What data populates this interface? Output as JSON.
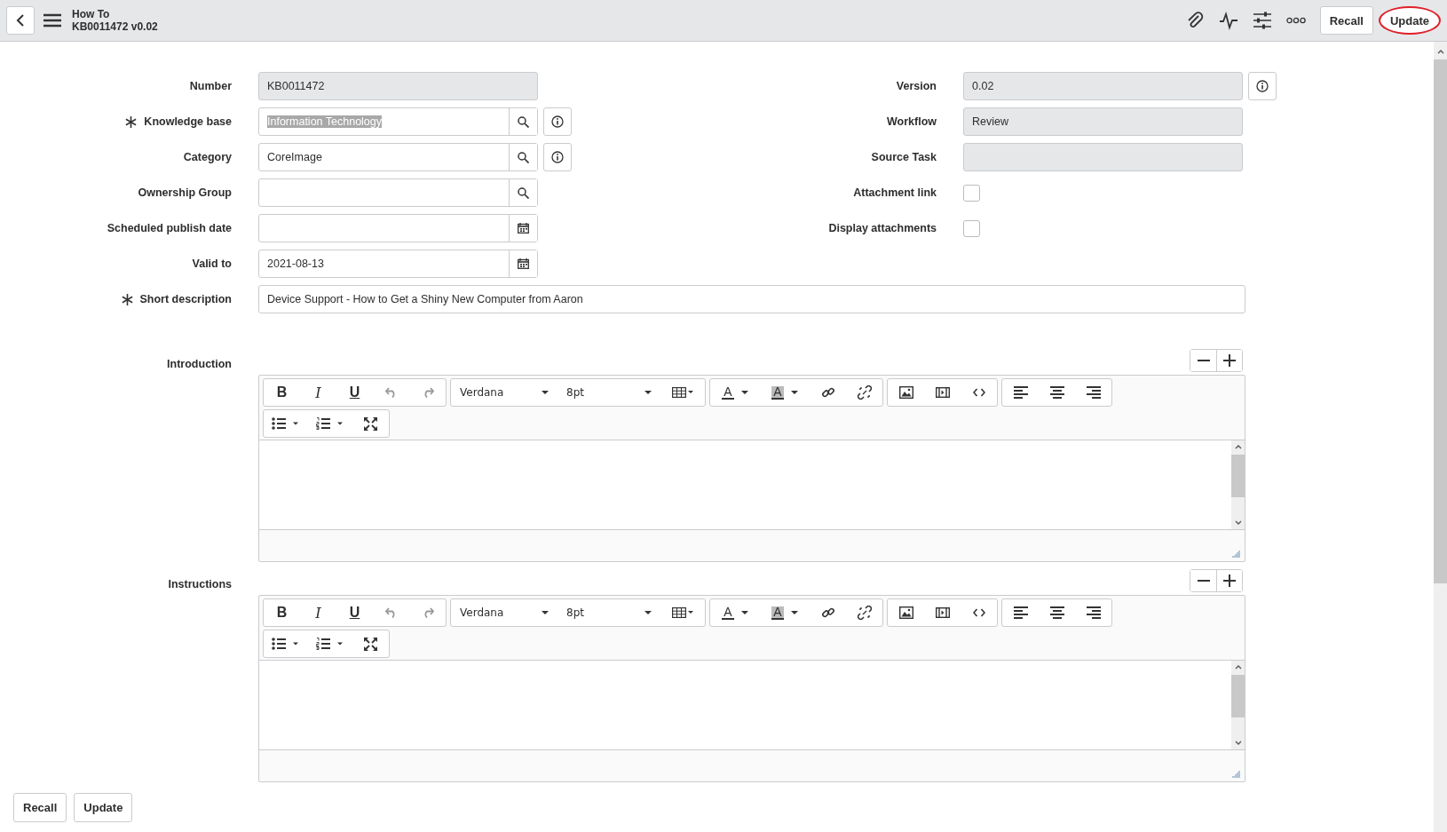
{
  "header": {
    "title": "How To",
    "subtitle": "KB0011472 v0.02",
    "buttons": [
      {
        "label": "Recall",
        "circled": false
      },
      {
        "label": "Update",
        "circled": true
      }
    ]
  },
  "left_fields": [
    {
      "label": "Number",
      "kind": "readonly",
      "value": "KB0011472",
      "required": false,
      "info": false
    },
    {
      "label": "Knowledge base",
      "kind": "reference",
      "value": "Information Technology",
      "required": true,
      "info": true,
      "text_selected": true
    },
    {
      "label": "Category",
      "kind": "reference",
      "value": "CoreImage",
      "required": false,
      "info": true,
      "text_selected": false
    },
    {
      "label": "Ownership Group",
      "kind": "reference",
      "required": false,
      "info": false
    },
    {
      "label": "Scheduled publish date",
      "kind": "date",
      "required": false,
      "info": false
    },
    {
      "label": "Valid to",
      "kind": "date",
      "value": "2021-08-13",
      "required": false,
      "info": false
    }
  ],
  "right_fields": [
    {
      "label": "Version",
      "kind": "readonly",
      "value": "0.02",
      "info": true
    },
    {
      "label": "Workflow",
      "kind": "readonly",
      "value": "Review",
      "info": false
    },
    {
      "label": "Source Task",
      "kind": "readonly",
      "info": false
    },
    {
      "label": "Attachment link",
      "kind": "checkbox",
      "checked": false
    },
    {
      "label": "Display attachments",
      "kind": "checkbox",
      "checked": false
    }
  ],
  "short_description": {
    "label": "Short description",
    "value": "Device Support - How to Get a Shiny New Computer from Aaron",
    "required": true
  },
  "editors": [
    {
      "label": "Introduction",
      "format_buttons": [
        "B",
        "I",
        "U"
      ],
      "font": "Verdana",
      "size": "8pt",
      "color_buttons": [
        "A",
        "A"
      ]
    },
    {
      "label": "Instructions",
      "format_buttons": [
        "B",
        "I",
        "U"
      ],
      "font": "Verdana",
      "size": "8pt",
      "color_buttons": [
        "A",
        "A"
      ]
    }
  ],
  "footer_buttons": [
    "Recall",
    "Update"
  ]
}
